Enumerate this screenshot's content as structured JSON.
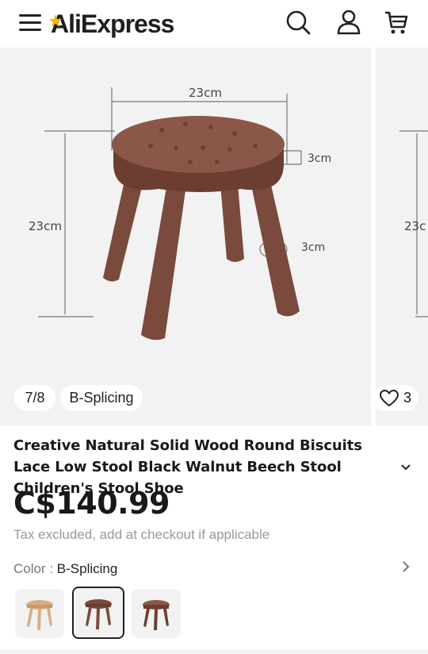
{
  "header": {
    "logo": "AliExpress",
    "icons": [
      "menu-icon",
      "search-icon",
      "user-icon",
      "cart-icon"
    ]
  },
  "gallery": {
    "counter": "7/8",
    "variant": "B-Splicing",
    "wishlist_count": "3",
    "image_labels": {
      "width": "23cm",
      "height": "23cm",
      "seat_thickness": "3cm",
      "leg_diameter": "3cm",
      "next_height": "23c"
    }
  },
  "product": {
    "title": "Creative Natural Solid Wood Round Biscuits Lace Low Stool Black Walnut Beech Stool Children's Stool Shoe",
    "price": "C$140.99",
    "tax_note": "Tax excluded, add at checkout if applicable",
    "color_label": "Color : ",
    "color_value": "B-Splicing"
  },
  "colors": {
    "walnut": "#7a4a3c",
    "beech": "#d9ad84",
    "text": "#191919",
    "muted": "#999999",
    "logo_accent": "#f5b800"
  }
}
